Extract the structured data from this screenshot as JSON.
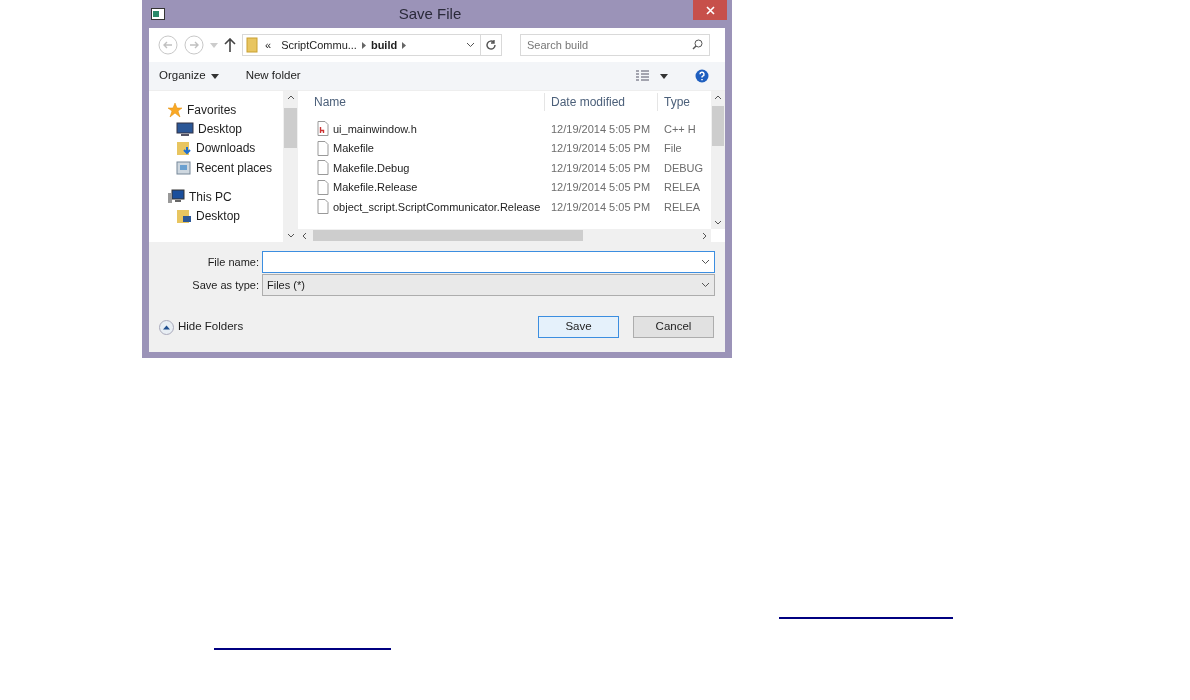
{
  "window": {
    "title": "Save File"
  },
  "address": {
    "crumbs": [
      "«",
      "ScriptCommu...",
      "build"
    ]
  },
  "search": {
    "placeholder": "Search build"
  },
  "toolbar": {
    "organize": "Organize",
    "new_folder": "New folder"
  },
  "sidebar": {
    "items": [
      {
        "label": "Favorites",
        "kind": "star",
        "children": [
          {
            "label": "Desktop",
            "kind": "desktop"
          },
          {
            "label": "Downloads",
            "kind": "downloads"
          },
          {
            "label": "Recent places",
            "kind": "recent"
          }
        ]
      },
      {
        "label": "This PC",
        "kind": "pc",
        "children": [
          {
            "label": "Desktop",
            "kind": "folder"
          }
        ]
      }
    ]
  },
  "table": {
    "columns": [
      "Name",
      "Date modified",
      "Type"
    ],
    "rows": [
      {
        "name": "ui_mainwindow.h",
        "kind": "header",
        "date": "12/19/2014 5:05 PM",
        "type": "C++ H"
      },
      {
        "name": "Makefile",
        "kind": "file",
        "date": "12/19/2014 5:05 PM",
        "type": "File"
      },
      {
        "name": "Makefile.Debug",
        "kind": "file",
        "date": "12/19/2014 5:05 PM",
        "type": "DEBUG"
      },
      {
        "name": "Makefile.Release",
        "kind": "file",
        "date": "12/19/2014 5:05 PM",
        "type": "RELEA"
      },
      {
        "name": "object_script.ScriptCommunicator.Release",
        "kind": "file",
        "date": "12/19/2014 5:05 PM",
        "type": "RELEA"
      }
    ]
  },
  "form": {
    "file_name_label": "File name:",
    "type_label": "Save as type:",
    "type_value": "Files (*)"
  },
  "hide_folders": "Hide Folders",
  "buttons": [
    {
      "label": "Save",
      "default": true
    },
    {
      "label": "Cancel",
      "default": false
    }
  ]
}
